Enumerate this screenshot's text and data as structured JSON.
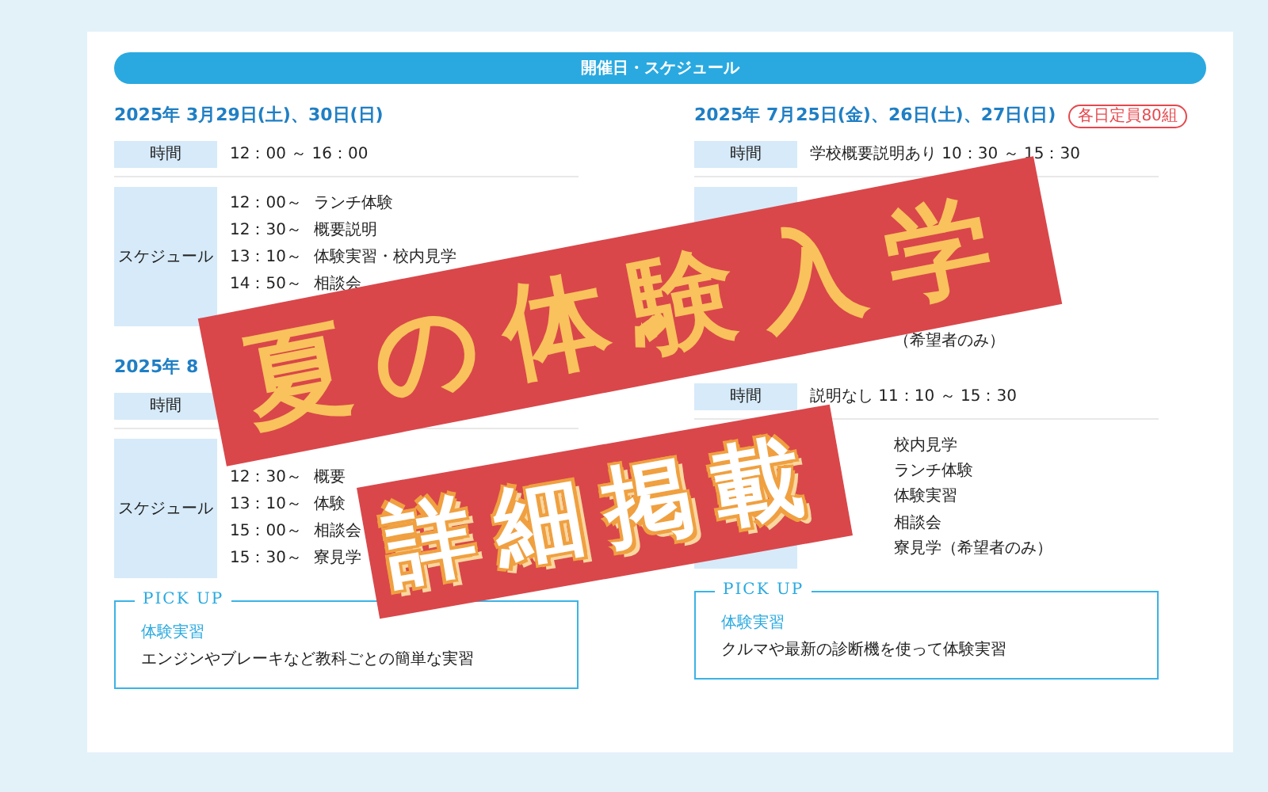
{
  "header": {
    "title": "開催日・スケジュール"
  },
  "columns": [
    {
      "sessions": [
        {
          "date": "2025年 3月29日(土)、30日(日)",
          "time_label": "時間",
          "time_value": "12：00 ～ 16：00",
          "schedule_label": "スケジュール",
          "schedule": [
            {
              "time": "12：00～",
              "activity": "ランチ体験"
            },
            {
              "time": "12：30～",
              "activity": "概要説明"
            },
            {
              "time": "13：10～",
              "activity": "体験実習・校内見学"
            },
            {
              "time": "14：50～",
              "activity": "相談会"
            }
          ]
        },
        {
          "date": "2025年 8",
          "time_label": "時間",
          "schedule_label": "スケジュール",
          "schedule": [
            {
              "time": "12：30～",
              "activity": "概要"
            },
            {
              "time": "13：10～",
              "activity": "体験"
            },
            {
              "time": "15：00～",
              "activity": "相談会"
            },
            {
              "time": "15：30～",
              "activity": "寮見学"
            }
          ]
        }
      ],
      "pickup": {
        "label": "PICK UP",
        "title": "体験実習",
        "text": "エンジンやブレーキなど教科ごとの簡単な実習"
      }
    },
    {
      "sessions": [
        {
          "date": "2025年 7月25日(金)、26日(土)、27日(日)",
          "badge": "各日定員80組",
          "time_label": "時間",
          "time_value": "学校概要説明あり 10：30 ～ 15：30",
          "schedule": [
            {
              "activity": "（希望者のみ）"
            }
          ]
        },
        {
          "time_label": "時間",
          "time_value": "説明なし 11：10 ～ 15：30",
          "schedule": [
            {
              "activity": "校内見学"
            },
            {
              "activity": "ランチ体験"
            },
            {
              "activity": "体験実習"
            },
            {
              "activity": "相談会"
            },
            {
              "activity": "寮見学（希望者のみ）"
            }
          ]
        }
      ],
      "pickup": {
        "label": "PICK UP",
        "title": "体験実習",
        "text": "クルマや最新の診断機を使って体験実習"
      }
    }
  ],
  "banners": [
    {
      "kind": "main",
      "text": "夏の体験入学"
    },
    {
      "kind": "sub",
      "text": "詳細掲載"
    }
  ]
}
